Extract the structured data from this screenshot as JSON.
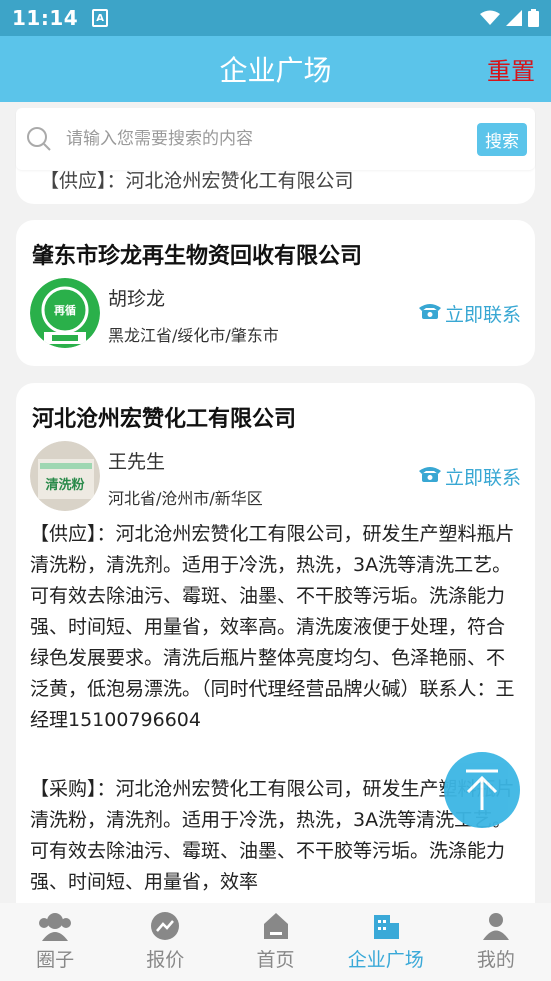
{
  "status": {
    "time": "11:14",
    "notif": "A"
  },
  "header": {
    "title": "企业广场",
    "reset": "重置"
  },
  "search": {
    "placeholder": "请输入您需要搜索的内容",
    "button": "搜索"
  },
  "companies": [
    {
      "name": "肇东市珍龙再生物资回收有限公司",
      "contact": "胡珍龙",
      "region": "黑龙江省/绥化市/肇东市",
      "action": "立即联系",
      "logo_text": "再循"
    },
    {
      "name": "河北沧州宏赞化工有限公司",
      "contact": "王先生",
      "region": "河北省/沧州市/新华区",
      "action": "立即联系",
      "avatar_text": "清洗粉",
      "supply": "【供应】：河北沧州宏赞化工有限公司，研发生产塑料瓶片清洗粉，清洗剂。适用于冷洗，热洗，3A洗等清洗工艺。可有效去除油污、霉斑、油墨、不干胶等污垢。洗涤能力强、时间短、用量省，效率高。清洗废液便于处理，符合绿色发展要求。清洗后瓶片整体亮度均匀、色泽艳丽、不泛黄，低泡易漂洗。（同时代理经营品牌火碱）联系人：王经理15100796604",
      "purchase": "【采购】：河北沧州宏赞化工有限公司，研发生产塑料瓶片清洗粉，清洗剂。适用于冷洗，热洗，3A洗等清洗工艺。可有效去除油污、霉斑、油墨、不干胶等污垢。洗涤能力强、时间短、用量省，效率"
    }
  ],
  "tabs": [
    {
      "label": "圈子",
      "icon": "group-icon"
    },
    {
      "label": "报价",
      "icon": "trend-icon"
    },
    {
      "label": "首页",
      "icon": "home-icon"
    },
    {
      "label": "企业广场",
      "icon": "building-icon",
      "active": true
    },
    {
      "label": "我的",
      "icon": "person-icon"
    }
  ],
  "colors": {
    "accent": "#5bc4ea",
    "reset": "#d6141a",
    "link": "#38a7d3"
  }
}
